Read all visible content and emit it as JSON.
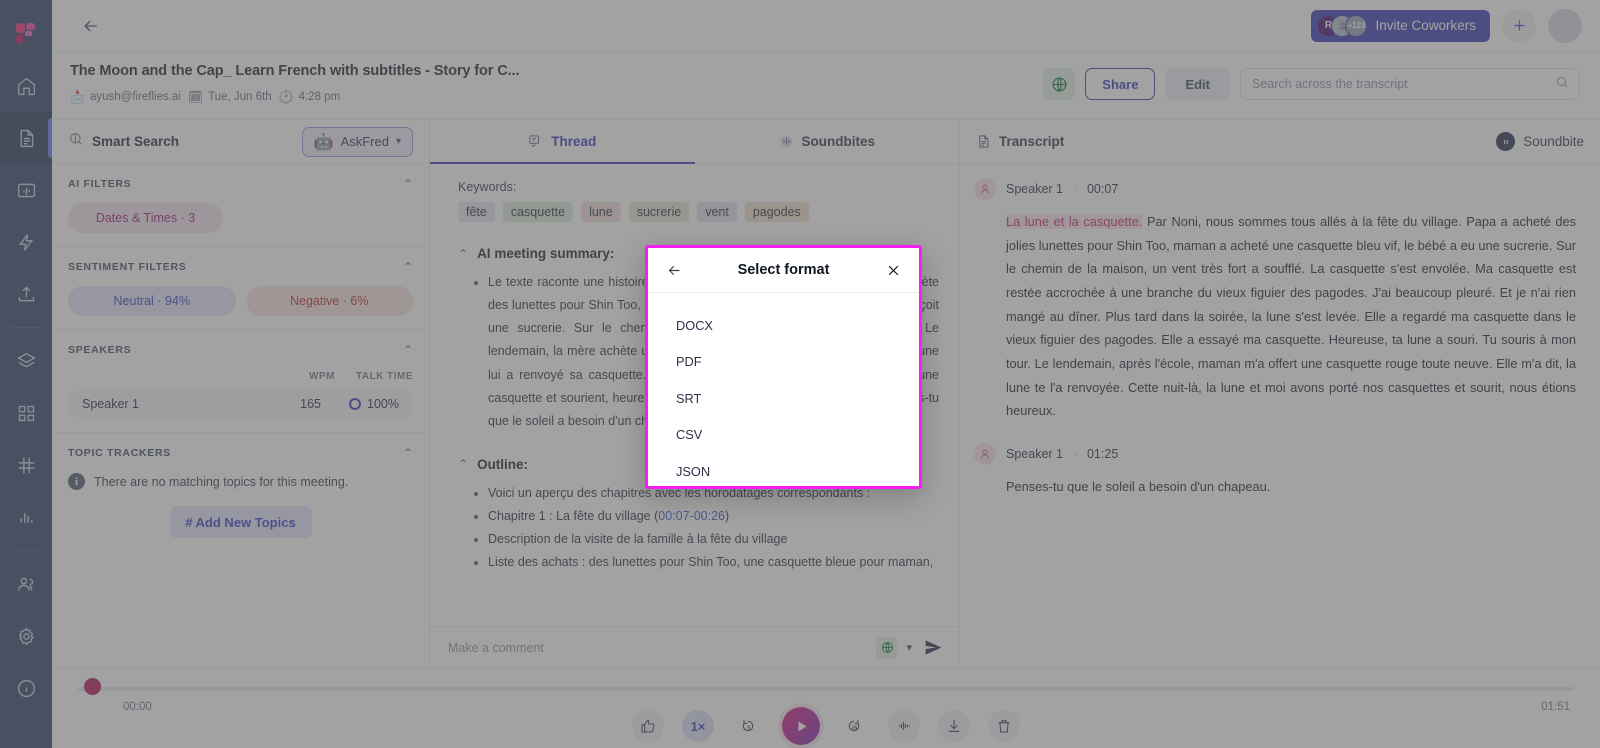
{
  "rail": {
    "logo_name": "fireflies-logo",
    "items": [
      {
        "name": "home",
        "icon": "home-icon",
        "active": false
      },
      {
        "name": "notes",
        "icon": "document-icon",
        "active": true
      },
      {
        "name": "soundbites",
        "icon": "soundbite-icon",
        "active": false
      },
      {
        "name": "automations",
        "icon": "lightning-icon",
        "active": false
      },
      {
        "name": "upload",
        "icon": "upload-icon",
        "active": false
      },
      {
        "name": "library",
        "icon": "layers-icon",
        "active": false
      },
      {
        "name": "apps",
        "icon": "grid-icon",
        "active": false
      },
      {
        "name": "topics",
        "icon": "hash-icon",
        "active": false
      },
      {
        "name": "analytics",
        "icon": "bar-chart-icon",
        "active": false
      },
      {
        "name": "team",
        "icon": "users-icon",
        "active": false
      },
      {
        "name": "settings",
        "icon": "gear-icon",
        "active": false
      },
      {
        "name": "help",
        "icon": "info-icon",
        "active": false
      }
    ]
  },
  "topbar": {
    "back_icon": "arrow-left-icon",
    "invite_label": "Invite Coworkers",
    "avatar_initial": "R",
    "avatar_overflow": "+123",
    "plus_icon": "plus-icon",
    "profile_icon": "user-avatar-icon"
  },
  "meeting": {
    "title": "The Moon and the Cap_ Learn French with subtitles - Story for C...",
    "owner": "ayush@fireflies.ai",
    "date": "Tue, Jun 6th",
    "time": "4:28 pm",
    "lang_icon": "globe-icon",
    "share_label": "Share",
    "edit_label": "Edit",
    "search_placeholder": "Search across the transcript",
    "search_value": ""
  },
  "left_panel": {
    "smart_search_label": "Smart Search",
    "askfred_label": "AskFred",
    "ai_filters": {
      "title": "AI FILTERS",
      "chips": [
        {
          "label": "Dates & Times · 3"
        }
      ]
    },
    "sentiment_filters": {
      "title": "SENTIMENT FILTERS",
      "chips": [
        {
          "label": "Neutral · 94%"
        },
        {
          "label": "Negative · 6%"
        }
      ]
    },
    "speakers": {
      "title": "SPEAKERS",
      "col_wpm": "WPM",
      "col_talk_time": "TALK TIME",
      "rows": [
        {
          "name": "Speaker 1",
          "wpm": "165",
          "talk_time": "100%"
        }
      ]
    },
    "topic_trackers": {
      "title": "TOPIC TRACKERS",
      "empty_text": "There are no matching topics for this meeting.",
      "add_label": "Add New Topics"
    }
  },
  "tabs": {
    "thread": "Thread",
    "soundbites": "Soundbites",
    "transcript": "Transcript",
    "soundbite_button": "Soundbite"
  },
  "thread": {
    "keywords_label": "Keywords:",
    "keywords": [
      {
        "text": "fête",
        "bg": "#e6e5f4"
      },
      {
        "text": "casquette",
        "bg": "#dcecdc"
      },
      {
        "text": "lune",
        "bg": "#f3dedd"
      },
      {
        "text": "sucrerie",
        "bg": "#e7e7d8"
      },
      {
        "text": "vent",
        "bg": "#e6def0"
      },
      {
        "text": "pagodes",
        "bg": "#eee0cf"
      }
    ],
    "summary_title": "AI meeting summary:",
    "summary_bullets": [
      "Le texte raconte une histoire où la famille va à la fête du village. Le père achète des lunettes pour Shin Too, la mère achète une casquette bleue et le bébé reçoit une sucrerie. Sur le chemin du retour, le vent emporte la casquette. Le lendemain, la mère achète une nouvelle casquette rouge et explique que la lune lui a renvoyé sa casquette. Cette nuit-là, la lune et lui portent tous deux une casquette et sourient, heureux. Le texte se termine par une question: \"Penses-tu que le soleil a besoin d'un chapeau ?\""
    ],
    "outline_title": "Outline:",
    "outline_bullets": [
      "Voici un aperçu des chapitres avec les horodatages correspondants :",
      "Chapitre 1 : La fête du village (00:07-00:26)",
      "Description de la visite de la famille à la fête du village",
      "Liste des achats : des lunettes pour Shin Too, une casquette bleue pour maman,"
    ],
    "chapter1_time": "00:07-00:26",
    "comment_placeholder": "Make a comment",
    "comment_value": "",
    "send_icon": "send-icon"
  },
  "transcript": {
    "segments": [
      {
        "speaker": "Speaker 1",
        "time": "00:07",
        "highlight": "La lune et la casquette.",
        "text": " Par Noni, nous sommes tous allés à la fête du village. Papa a acheté des jolies lunettes pour Shin Too, maman a acheté une casquette bleu vif, le bébé a eu une sucrerie. Sur le chemin de la maison, un vent très fort a soufflé. La casquette s'est envolée. Ma casquette est restée accrochée à une branche du vieux figuier des pagodes. J'ai beaucoup pleuré. Et je n'ai rien mangé au dîner. Plus tard dans la soirée, la lune s'est levée. Elle a regardé ma casquette dans le vieux figuier des pagodes. Elle a essayé ma casquette. Heureuse, ta lune a souri. Tu souris à mon tour. Le lendemain, après l'école, maman m'a offert une casquette rouge toute neuve. Elle m'a dit, la lune te l'a renvoyée. Cette nuit-là, la lune et moi avons porté nos casquettes et sourit, nous étions heureux."
      },
      {
        "speaker": "Speaker 1",
        "time": "01:25",
        "highlight": "",
        "text": "Penses-tu que le soleil a besoin d'un chapeau."
      }
    ]
  },
  "player": {
    "current_time": "00:00",
    "total_time": "01:51",
    "speed": "1×",
    "rewind_seconds": "5",
    "forward_seconds": "15",
    "buttons": [
      "thumbs-up-icon",
      "speed-button",
      "rewind-5-icon",
      "play-icon",
      "forward-15-icon",
      "waveform-icon",
      "download-icon",
      "trash-icon"
    ]
  },
  "modal": {
    "title": "Select format",
    "back_icon": "arrow-left-icon",
    "close_icon": "close-icon",
    "options": [
      "DOCX",
      "PDF",
      "SRT",
      "CSV",
      "JSON"
    ],
    "border_color": "#f51ff5"
  }
}
